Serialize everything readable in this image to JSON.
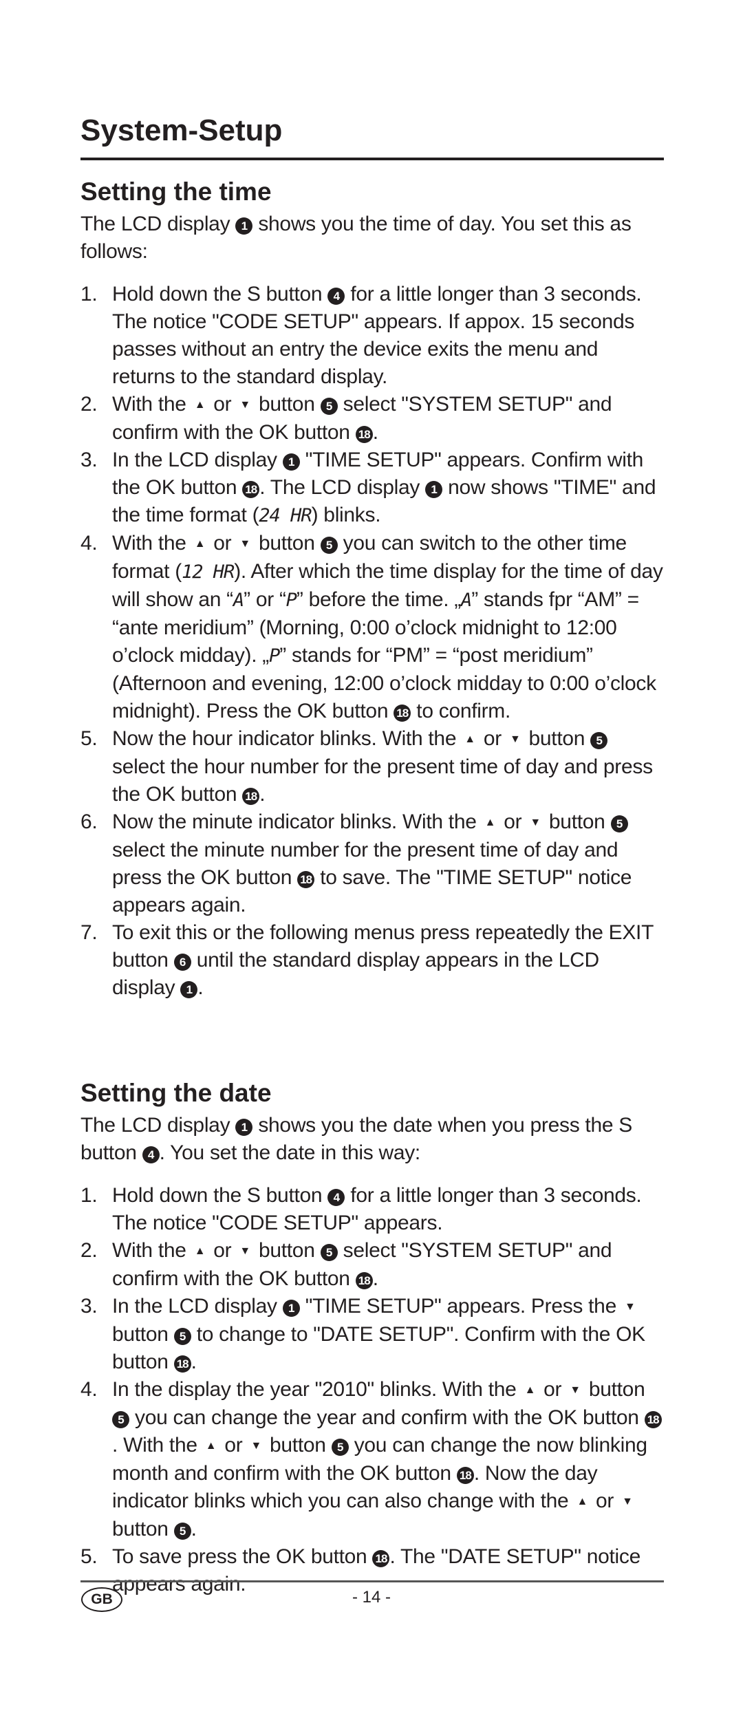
{
  "document": {
    "title": "System-Setup",
    "sections": [
      {
        "heading": "Setting the time",
        "intro": [
          {
            "t": "The LCD display "
          },
          {
            "c": "1"
          },
          {
            "t": " shows you the time of day. You set this as follows:"
          }
        ],
        "steps": [
          {
            "num": "1.",
            "content": [
              {
                "t": "Hold down the S button "
              },
              {
                "c": "4"
              },
              {
                "t": " for a little longer than 3 seconds. The notice \"CODE SETUP\" appears. If appox. 15 seconds passes without an entry the device exits the menu and returns to the standard display."
              }
            ]
          },
          {
            "num": "2.",
            "content": [
              {
                "t": "With the "
              },
              {
                "i": "up"
              },
              {
                "t": " or "
              },
              {
                "i": "down"
              },
              {
                "t": " button "
              },
              {
                "c": "5"
              },
              {
                "t": " select \"SYSTEM SETUP\" and confirm with the OK button "
              },
              {
                "c": "18"
              },
              {
                "t": "."
              }
            ]
          },
          {
            "num": "3.",
            "content": [
              {
                "t": "In the LCD display "
              },
              {
                "c": "1"
              },
              {
                "t": " \"TIME SETUP\" appears. Confirm with the OK button "
              },
              {
                "c": "18"
              },
              {
                "t": ".  The LCD display "
              },
              {
                "c": "1"
              },
              {
                "t": " now shows \"TIME\" and the time format ("
              },
              {
                "l": "24 HR"
              },
              {
                "t": ") blinks."
              }
            ]
          },
          {
            "num": "4.",
            "content": [
              {
                "t": "With the "
              },
              {
                "i": "up"
              },
              {
                "t": " or "
              },
              {
                "i": "down"
              },
              {
                "t": " button "
              },
              {
                "c": "5"
              },
              {
                "t": " you can switch to the other time format ("
              },
              {
                "l": "12 HR"
              },
              {
                "t": "). After which the time display for the time of day will show an “"
              },
              {
                "l": "A"
              },
              {
                "t": "” or “"
              },
              {
                "l": "P"
              },
              {
                "t": "” before the time. „"
              },
              {
                "l": "A"
              },
              {
                "t": "” stands fpr “AM” = “ante meridium” (Morning, 0:00 o’clock midnight to 12:00 o’clock midday). „"
              },
              {
                "l": "P"
              },
              {
                "t": "” stands for “PM” = “post meridium” (Afternoon and evening, 12:00 o’clock midday to 0:00 o’clock midnight). Press the OK button "
              },
              {
                "c": "18"
              },
              {
                "t": " to confirm."
              }
            ]
          },
          {
            "num": "5.",
            "content": [
              {
                "t": "Now the hour indicator blinks. With the "
              },
              {
                "i": "up"
              },
              {
                "t": " or "
              },
              {
                "i": "down"
              },
              {
                "t": " button "
              },
              {
                "c": "5"
              },
              {
                "t": " select the hour number for the present time of day and press the OK button "
              },
              {
                "c": "18"
              },
              {
                "t": "."
              }
            ]
          },
          {
            "num": "6.",
            "content": [
              {
                "t": "Now the minute indicator blinks. With the "
              },
              {
                "i": "up"
              },
              {
                "t": " or "
              },
              {
                "i": "down"
              },
              {
                "t": " button "
              },
              {
                "c": "5"
              },
              {
                "t": " select the minute number for the present time of day and press the OK button "
              },
              {
                "c": "18"
              },
              {
                "t": " to save. The \"TIME SETUP\" notice appears again."
              }
            ]
          },
          {
            "num": "7.",
            "content": [
              {
                "t": "To exit this or the following menus press repeatedly the EXIT button "
              },
              {
                "c": "6"
              },
              {
                "t": " until the standard display appears in the LCD display "
              },
              {
                "c": "1"
              },
              {
                "t": "."
              }
            ]
          }
        ]
      },
      {
        "heading": "Setting the date",
        "intro": [
          {
            "t": "The LCD display "
          },
          {
            "c": "1"
          },
          {
            "t": " shows you the date when you press the S button "
          },
          {
            "c": "4"
          },
          {
            "t": ". You set the date in this way:"
          }
        ],
        "steps": [
          {
            "num": "1.",
            "content": [
              {
                "t": "Hold down the S button "
              },
              {
                "c": "4"
              },
              {
                "t": " for a little longer than 3 sec­onds. The notice \"CODE SETUP\" appears."
              }
            ]
          },
          {
            "num": "2.",
            "content": [
              {
                "t": "With the "
              },
              {
                "i": "up"
              },
              {
                "t": " or "
              },
              {
                "i": "down"
              },
              {
                "t": " button "
              },
              {
                "c": "5"
              },
              {
                "t": " select \"SYSTEM SETUP\" and confirm with the OK button "
              },
              {
                "c": "18"
              },
              {
                "t": "."
              }
            ]
          },
          {
            "num": "3.",
            "content": [
              {
                "t": "In the LCD display "
              },
              {
                "c": "1"
              },
              {
                "t": " \"TIME SETUP\" appears. Press the "
              },
              {
                "i": "down"
              },
              {
                "t": " button "
              },
              {
                "c": "5"
              },
              {
                "t": " to change to \"DATE SETUP\". Confirm with the OK button "
              },
              {
                "c": "18"
              },
              {
                "t": "."
              }
            ]
          },
          {
            "num": "4.",
            "content": [
              {
                "t": "In the display the year \"2010\" blinks. With the "
              },
              {
                "i": "up"
              },
              {
                "t": " or "
              },
              {
                "i": "down"
              },
              {
                "t": " button "
              },
              {
                "c": "5"
              },
              {
                "t": " you can change the year and confirm with the OK button "
              },
              {
                "c": "18"
              },
              {
                "t": ". With the "
              },
              {
                "i": "up"
              },
              {
                "t": " or "
              },
              {
                "i": "down"
              },
              {
                "t": " button "
              },
              {
                "c": "5"
              },
              {
                "t": " you can change the now blinking month and confirm with the OK button "
              },
              {
                "c": "18"
              },
              {
                "t": ". Now the day indicator blinks which you can also change with the "
              },
              {
                "i": "up"
              },
              {
                "t": " or "
              },
              {
                "i": "down"
              },
              {
                "t": " button "
              },
              {
                "c": "5"
              },
              {
                "t": "."
              }
            ]
          },
          {
            "num": "5.",
            "content": [
              {
                "t": "To save press the OK button "
              },
              {
                "c": "18"
              },
              {
                "t": ". The \"DATE SETUP\" notice appears again."
              }
            ]
          }
        ]
      }
    ]
  },
  "icons": {
    "up": "▲",
    "down": "▼"
  },
  "footer": {
    "language_badge": "GB",
    "page_number": "- 14 -"
  }
}
